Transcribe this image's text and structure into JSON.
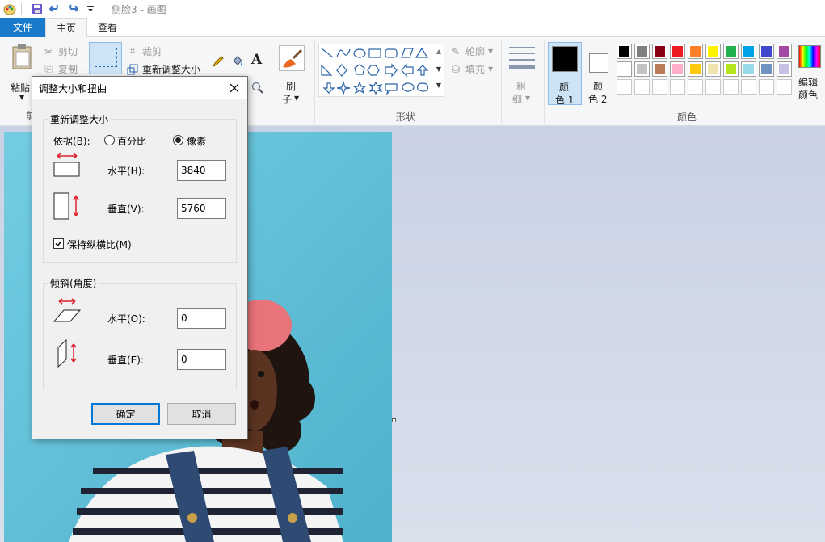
{
  "app": {
    "title": "侧脸3 - 画图"
  },
  "tabs": [
    {
      "label": "文件"
    },
    {
      "label": "主页"
    },
    {
      "label": "查看"
    }
  ],
  "ribbon": {
    "clipboard": {
      "paste": "粘贴",
      "cut": "剪切",
      "copy": "复制",
      "group_label": "剪"
    },
    "image": {
      "crop": "裁剪",
      "resize": "重新调整大小"
    },
    "brushes": {
      "label_line1": "刷",
      "label_line2": "子"
    },
    "shapes": {
      "outline": "轮廓",
      "fill": "填充",
      "group_label": "形状"
    },
    "size": {
      "label_line1": "粗",
      "label_line2": "细"
    },
    "colors": {
      "color1_line1": "颜",
      "color1_line2": "色 1",
      "color2_line1": "颜",
      "color2_line2": "色 2",
      "edit_line1": "编辑",
      "edit_line2": "颜色",
      "group_label": "颜色",
      "palette_row1": [
        "#000000",
        "#7f7f7f",
        "#880015",
        "#ed1c24",
        "#ff7f27",
        "#fff200",
        "#22b14c",
        "#00a2e8",
        "#3f48cc",
        "#a349a4"
      ],
      "palette_row2": [
        "#ffffff",
        "#c3c3c3",
        "#b97a57",
        "#ffaec9",
        "#ffc90e",
        "#efe4b0",
        "#b5e61d",
        "#99d9ea",
        "#7092be",
        "#c8bfe7"
      ],
      "palette_row3_count": 10
    }
  },
  "dialog": {
    "title": "调整大小和扭曲",
    "resize_section": {
      "legend": "重新调整大小",
      "by_label": "依据(B):",
      "percent_label": "百分比",
      "pixels_label": "像素",
      "selected": "pixels",
      "horizontal_label": "水平(H):",
      "horizontal_value": "3840",
      "vertical_label": "垂直(V):",
      "vertical_value": "5760",
      "keep_ratio_label": "保持纵横比(M)",
      "keep_ratio_checked": true
    },
    "skew_section": {
      "legend": "倾斜(角度)",
      "horizontal_label": "水平(O):",
      "horizontal_value": "0",
      "vertical_label": "垂直(E):",
      "vertical_value": "0"
    },
    "ok_label": "确定",
    "cancel_label": "取消"
  },
  "theme": {
    "file_tab": "#1979ca",
    "canvas_bg": "#62c0d8",
    "arrow_red": "#e0202a"
  }
}
